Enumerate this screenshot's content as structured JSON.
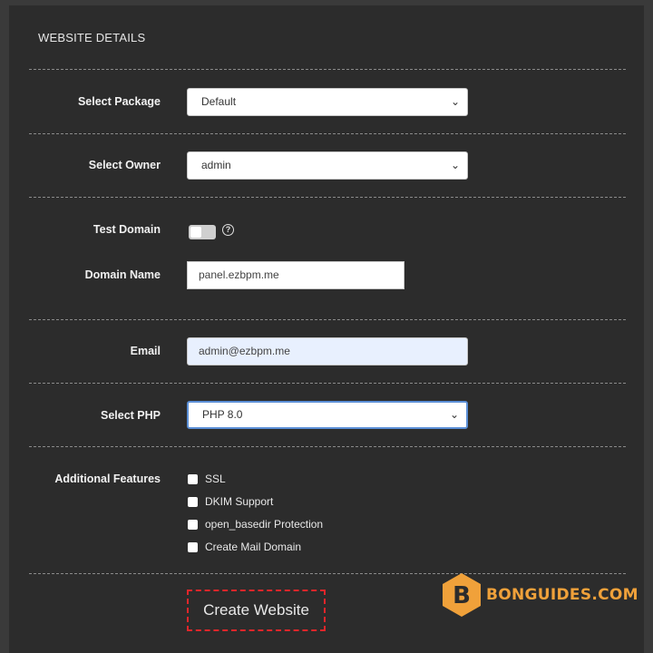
{
  "section_title": "WEBSITE DETAILS",
  "fields": {
    "package": {
      "label": "Select Package",
      "value": "Default"
    },
    "owner": {
      "label": "Select Owner",
      "value": "admin"
    },
    "test_domain": {
      "label": "Test Domain",
      "help": "?"
    },
    "domain_name": {
      "label": "Domain Name",
      "value": "panel.ezbpm.me"
    },
    "email": {
      "label": "Email",
      "value": "admin@ezbpm.me"
    },
    "php": {
      "label": "Select PHP",
      "value": "PHP 8.0"
    }
  },
  "features": {
    "label": "Additional Features",
    "items": [
      {
        "label": "SSL",
        "checked": false
      },
      {
        "label": "DKIM Support",
        "checked": false
      },
      {
        "label": "open_basedir Protection",
        "checked": false
      },
      {
        "label": "Create Mail Domain",
        "checked": false
      }
    ]
  },
  "create_button": {
    "label": "Create Website"
  },
  "watermark": {
    "letter": "B",
    "text": "BONGUIDES.COM",
    "color": "#f0a13a"
  },
  "icons": {
    "dropdown": "chevron-down-icon",
    "help": "question-circle-icon"
  }
}
